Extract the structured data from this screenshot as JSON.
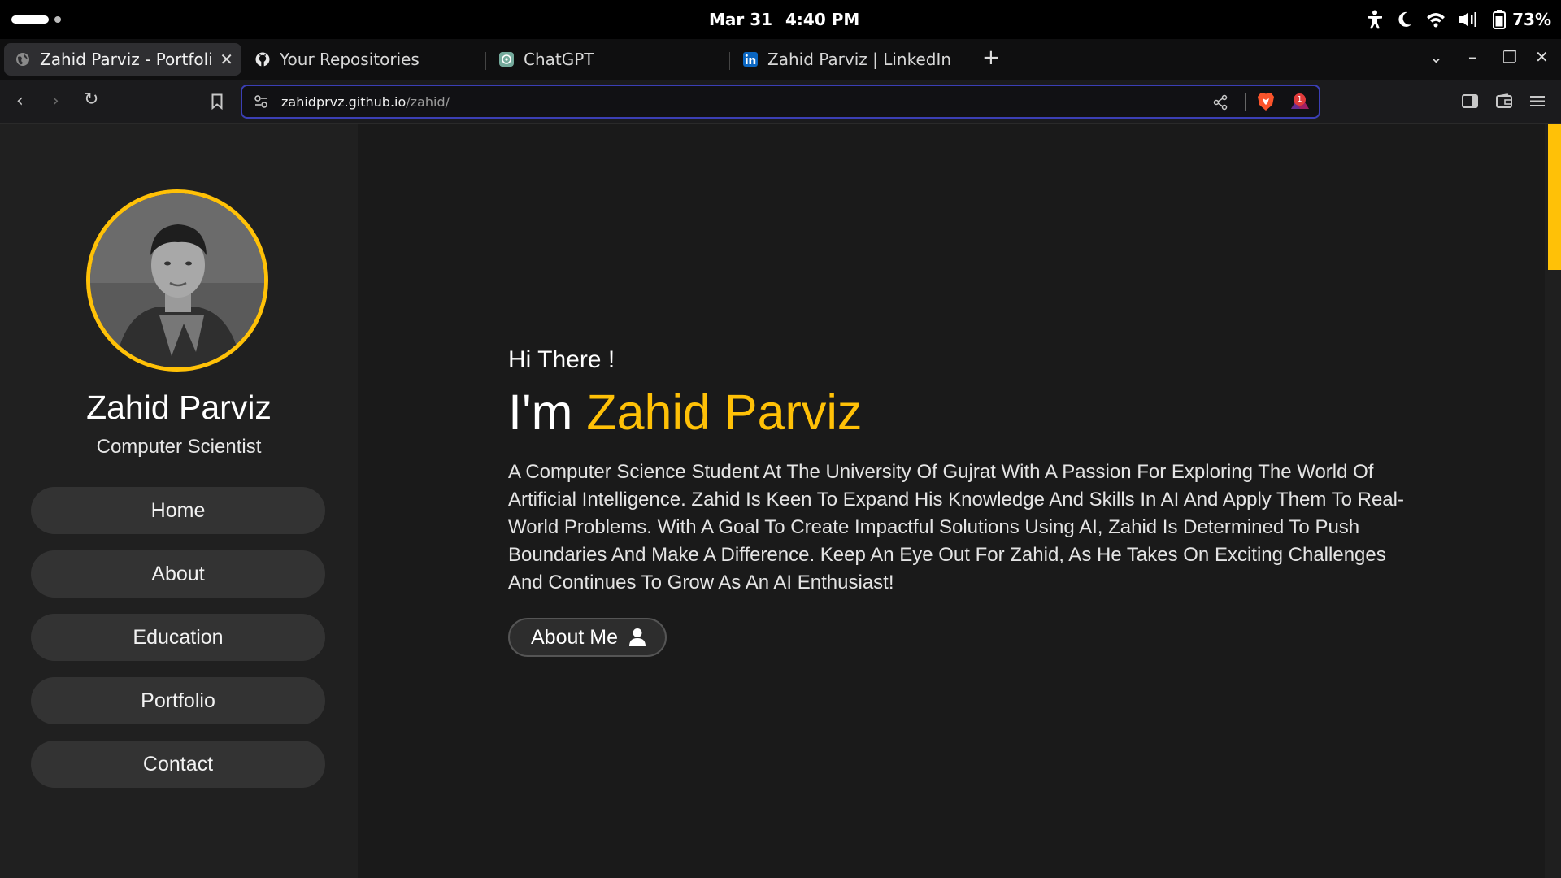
{
  "system": {
    "date": "Mar 31",
    "time": "4:40 PM",
    "battery": "73%",
    "icons": [
      "accessibility-icon",
      "night-mode-icon",
      "wifi-icon",
      "volume-icon",
      "battery-icon"
    ]
  },
  "tabs": [
    {
      "title": "Zahid Parviz - Portfolio",
      "icon": "globe-icon",
      "active": true
    },
    {
      "title": "Your Repositories",
      "icon": "github-icon",
      "active": false
    },
    {
      "title": "ChatGPT",
      "icon": "chatgpt-icon",
      "active": false
    },
    {
      "title": "Zahid Parviz | LinkedIn",
      "icon": "linkedin-icon",
      "active": false
    }
  ],
  "addressbar": {
    "domain": "zahidprvz.github.io",
    "path": "/zahid/",
    "rewards_badge": "1"
  },
  "sidebar": {
    "name": "Zahid Parviz",
    "role": "Computer Scientist",
    "nav": [
      "Home",
      "About",
      "Education",
      "Portfolio",
      "Contact"
    ]
  },
  "hero": {
    "greeting": "Hi There !",
    "im_prefix": "I'm ",
    "name": "Zahid Parviz",
    "description": "A Computer Science Student At The University Of Gujrat With A Passion For Exploring The World Of Artificial Intelligence. Zahid Is Keen To Expand His Knowledge And Skills In AI And Apply Them To Real-World Problems. With A Goal To Create Impactful Solutions Using AI, Zahid Is Determined To Push Boundaries And Make A Difference. Keep An Eye Out For Zahid, As He Takes On Exciting Challenges And Continues To Grow As An AI Enthusiast!",
    "button": "About Me"
  },
  "colors": {
    "accent": "#ffc107",
    "sidebar_bg": "#202020",
    "main_bg": "#1a1a1a",
    "nav_button_bg": "#333333"
  }
}
